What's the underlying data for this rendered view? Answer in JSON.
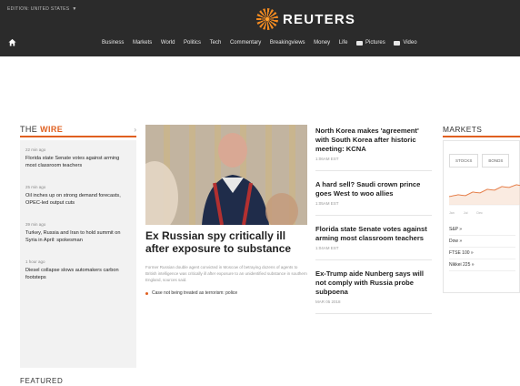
{
  "header": {
    "edition": "EDITION: UNITED STATES",
    "logo_text": "REUTERS",
    "nav": [
      {
        "label": "Business"
      },
      {
        "label": "Markets"
      },
      {
        "label": "World"
      },
      {
        "label": "Politics"
      },
      {
        "label": "Tech"
      },
      {
        "label": "Commentary"
      },
      {
        "label": "Breakingviews"
      },
      {
        "label": "Money"
      },
      {
        "label": "Life"
      },
      {
        "label": "Pictures",
        "icon": "camera-icon"
      },
      {
        "label": "Video",
        "icon": "video-icon"
      }
    ]
  },
  "wire": {
    "title_plain": "THE ",
    "title_accent": "WIRE",
    "items": [
      {
        "time": "22 min ago",
        "headline": "Florida state Senate votes against arming most classroom teachers"
      },
      {
        "time": "25 min ago",
        "headline": "Oil inches up on strong demand forecasts, OPEC-led output cuts"
      },
      {
        "time": "39 min ago",
        "headline": "Turkey, Russia and Iran to hold summit on Syria in April: spokesman"
      },
      {
        "time": "1 hour ago",
        "headline": "Diesel collapse slows automakers carbon footsteps"
      }
    ]
  },
  "hero": {
    "title": "Ex Russian spy critically ill after exposure to substance",
    "summary": "Former Russian double agent convicted in Moscow of betraying dozens of agents to British intelligence was critically ill after exposure to an unidentified substance in southern England, sources said.",
    "related": "Case not being treated as terrorism: police"
  },
  "stories": [
    {
      "title": "North Korea makes 'agreement' with South Korea after historic meeting: KCNA",
      "time": "1:06AM EST"
    },
    {
      "title": "A hard sell? Saudi crown prince goes West to woo allies",
      "time": "1:05AM EST"
    },
    {
      "title": "Florida state Senate votes against arming most classroom teachers",
      "time": "1:04AM EST"
    },
    {
      "title": "Ex-Trump aide Nunberg says will not comply with Russia probe subpoena",
      "time": "MAR 05 2018"
    }
  ],
  "markets": {
    "title": "MARKETS",
    "tabs": [
      "STOCKS",
      "BONDS"
    ],
    "axis": [
      "Jan",
      "Jul",
      "Dec"
    ],
    "indices": [
      "S&P »",
      "Dow »",
      "FTSE 100 »",
      "Nikkei 225 »"
    ]
  },
  "featured": {
    "title": "FEATURED"
  },
  "colors": {
    "header_bg": "#2b2b2b",
    "accent": "#e06020",
    "logo_orange": "#f28a20"
  }
}
